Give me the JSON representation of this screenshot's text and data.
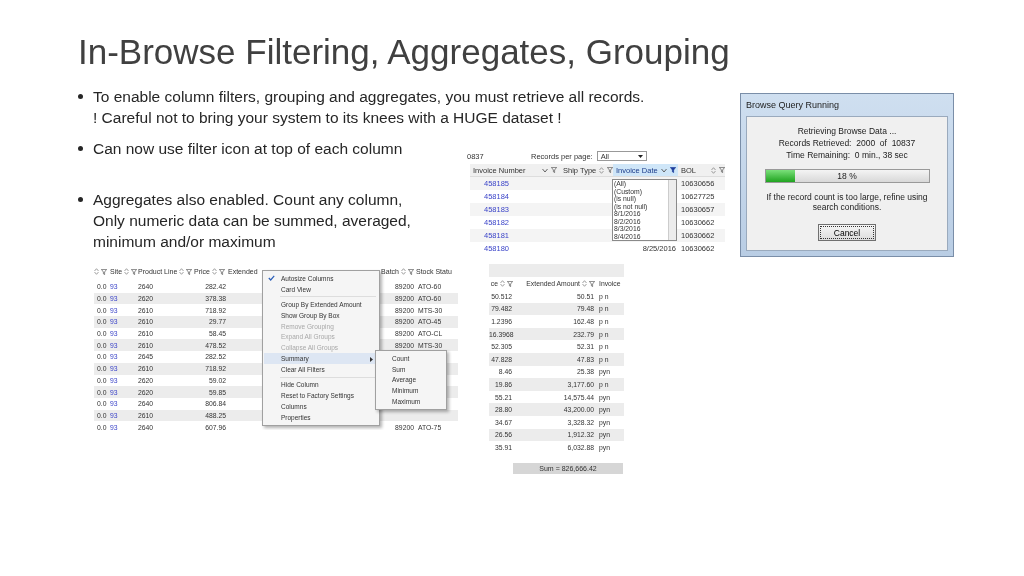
{
  "slide": {
    "title": "In-Browse Filtering, Aggregates, Grouping"
  },
  "bullets": [
    {
      "lines": [
        "To enable column filters, grouping and aggregates, you must retrieve all records.",
        "! Careful not to bring your system to its knees with a HUGE dataset !"
      ]
    },
    {
      "lines": [
        "Can now use filter icon at top of each column"
      ]
    },
    {
      "lines": [
        "Aggregates also enabled. Count any column,",
        "Only numeric data can be summed, averaged,",
        "minimum and/or maximum"
      ]
    }
  ],
  "filter_grid": {
    "record_count": "0837",
    "records_label": "Records per page:",
    "records_value": "All",
    "columns": [
      {
        "label": "Invoice Number",
        "sorted": true,
        "filtered": false
      },
      {
        "label": "Ship Type",
        "sorted": false,
        "filtered": false
      },
      {
        "label": "Invoice Date",
        "sorted": true,
        "filtered": true
      },
      {
        "label": "BOL",
        "sorted": false,
        "filtered": false
      }
    ],
    "rows": [
      {
        "invoice": "458185",
        "bol": "10630656"
      },
      {
        "invoice": "458184",
        "bol": "10627725"
      },
      {
        "invoice": "458183",
        "bol": "10630657"
      },
      {
        "invoice": "458182",
        "bol": "10630662"
      },
      {
        "invoice": "458181",
        "bol": "10630662"
      },
      {
        "invoice": "458180",
        "date": "8/25/2016",
        "bol": "10630662"
      }
    ],
    "filter_options": [
      "(All)",
      "(Custom)",
      "(is null)",
      "(is not null)",
      "8/1/2016",
      "8/2/2016",
      "8/3/2016",
      "8/4/2016"
    ]
  },
  "progress_dialog": {
    "title": "Browse Query Running",
    "lines": [
      "Retrieving Browse Data ...",
      "Records Retrieved:  2000  of  10837",
      "Time Remaining:  0 min., 38 sec"
    ],
    "level": 0.18,
    "percent": "18 %",
    "note": "If the record count is too large, refine using search conditions.",
    "button": "Cancel"
  },
  "context_grid": {
    "columns": [
      {
        "icons": true
      },
      {
        "label": "Site",
        "icons": true
      },
      {
        "label": "Product Line",
        "icons": true
      },
      {
        "label": "Price",
        "icons": true
      },
      {
        "label": "Extended",
        "icons": false
      },
      {
        "label": "Batch",
        "icons": true
      },
      {
        "label": "Stock Statu"
      }
    ],
    "rows": [
      {
        "cells": [
          "0.0",
          "93",
          "2640",
          "282.42",
          "",
          "89200",
          "ATO-60"
        ]
      },
      {
        "cells": [
          "0.0",
          "93",
          "2620",
          "378.38",
          "",
          "89200",
          "ATO-60"
        ]
      },
      {
        "cells": [
          "0.0",
          "93",
          "2610",
          "718.92",
          "",
          "89200",
          "MTS-30"
        ]
      },
      {
        "cells": [
          "0.0",
          "93",
          "2610",
          "29.77",
          "",
          "89200",
          "ATO-45"
        ]
      },
      {
        "cells": [
          "0.0",
          "93",
          "2610",
          "58.45",
          "",
          "89200",
          "ATO-CL"
        ]
      },
      {
        "cells": [
          "0.0",
          "93",
          "2610",
          "478.52",
          "",
          "89200",
          "MTS-30"
        ]
      },
      {
        "cells": [
          "0.0",
          "93",
          "2645",
          "282.52",
          "",
          "",
          ""
        ]
      },
      {
        "cells": [
          "0.0",
          "93",
          "2610",
          "718.92",
          "",
          "",
          ""
        ]
      },
      {
        "cells": [
          "0.0",
          "93",
          "2620",
          "59.02",
          "",
          "",
          ""
        ]
      },
      {
        "cells": [
          "0.0",
          "93",
          "2620",
          "59.85",
          "",
          "",
          ""
        ]
      },
      {
        "cells": [
          "0.0",
          "93",
          "2640",
          "806.84",
          "",
          "",
          ""
        ]
      },
      {
        "cells": [
          "0.0",
          "93",
          "2610",
          "488.25",
          "",
          "",
          ""
        ]
      },
      {
        "cells": [
          "0.0",
          "93",
          "2640",
          "607.96",
          "",
          "89200",
          "ATO-75"
        ]
      }
    ],
    "menu": [
      {
        "label": "Autosize Columns",
        "checked": true,
        "disabled": false,
        "selected": false,
        "separator_before": false,
        "has_submenu": false
      },
      {
        "label": "Card View",
        "checked": false,
        "disabled": false,
        "selected": false,
        "separator_before": false,
        "has_submenu": false
      },
      {
        "label": "Group By Extended Amount",
        "checked": false,
        "disabled": false,
        "selected": false,
        "separator_before": true,
        "has_submenu": false
      },
      {
        "label": "Show Group By Box",
        "checked": false,
        "disabled": false,
        "selected": false,
        "separator_before": false,
        "has_submenu": false
      },
      {
        "label": "Remove Grouping",
        "checked": false,
        "disabled": true,
        "selected": false,
        "separator_before": false,
        "has_submenu": false
      },
      {
        "label": "Expand All Groups",
        "checked": false,
        "disabled": true,
        "selected": false,
        "separator_before": false,
        "has_submenu": false
      },
      {
        "label": "Collapse All Groups",
        "checked": false,
        "disabled": true,
        "selected": false,
        "separator_before": false,
        "has_submenu": false
      },
      {
        "label": "Summary",
        "checked": false,
        "disabled": false,
        "selected": true,
        "separator_before": false,
        "has_submenu": true
      },
      {
        "label": "Clear All Filters",
        "checked": false,
        "disabled": false,
        "selected": false,
        "separator_before": false,
        "has_submenu": false
      },
      {
        "label": "Hide Column",
        "checked": false,
        "disabled": false,
        "selected": false,
        "separator_before": true,
        "has_submenu": false
      },
      {
        "label": "Reset to Factory Settings",
        "checked": false,
        "disabled": false,
        "selected": false,
        "separator_before": false,
        "has_submenu": false
      },
      {
        "label": "Columns",
        "checked": false,
        "disabled": false,
        "selected": false,
        "separator_before": false,
        "has_submenu": false
      },
      {
        "label": "Properties",
        "checked": false,
        "disabled": false,
        "selected": false,
        "separator_before": false,
        "has_submenu": false
      }
    ],
    "submenu": [
      "Count",
      "Sum",
      "Average",
      "Minimum",
      "Maximum"
    ]
  },
  "sum_grid": {
    "columns": [
      {
        "label": "ce",
        "filter_icons": true
      },
      {
        "label": "Extended Amount",
        "filter_icons": true
      },
      {
        "label": "Invoice",
        "filter_icons": false
      }
    ],
    "rows": [
      [
        "50.512",
        "50.51",
        "p n"
      ],
      [
        "79.482",
        "79.48",
        "p n"
      ],
      [
        "1.2396",
        "162.48",
        "p n"
      ],
      [
        "16.3968",
        "232.79",
        "p n"
      ],
      [
        "52.305",
        "52.31",
        "p n"
      ],
      [
        "47.828",
        "47.83",
        "p n"
      ],
      [
        "8.46",
        "25.38",
        "pyn"
      ],
      [
        "19.86",
        "3,177.60",
        "p n"
      ],
      [
        "55.21",
        "14,575.44",
        "pyn"
      ],
      [
        "28.80",
        "43,200.00",
        "pyn"
      ],
      [
        "34.67",
        "3,328.32",
        "pyn"
      ],
      [
        "26.56",
        "1,912.32",
        "pyn"
      ],
      [
        "35.91",
        "6,032.88",
        "pyn"
      ]
    ],
    "sum": "Sum = 826,666.42"
  }
}
